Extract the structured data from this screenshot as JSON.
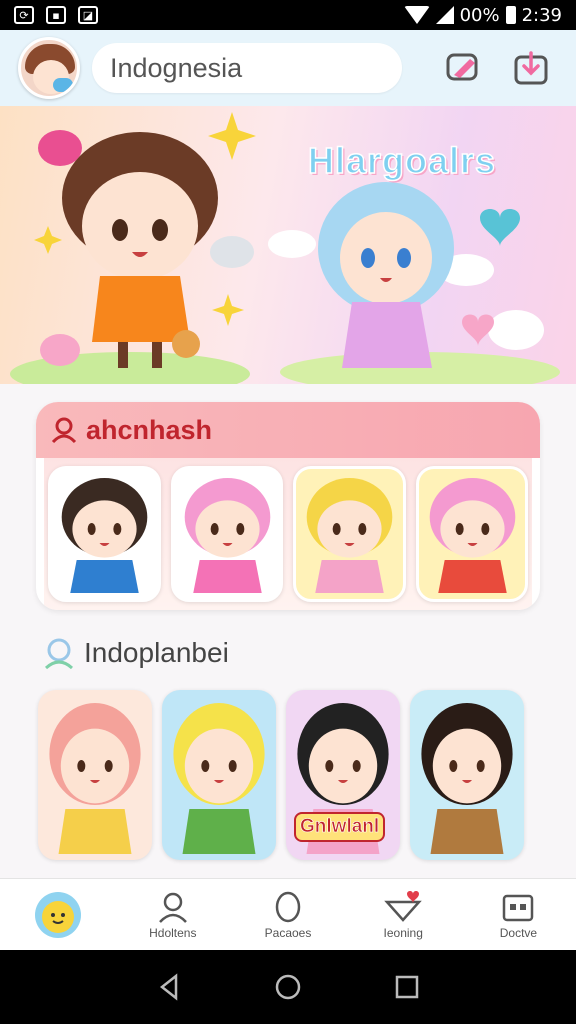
{
  "status_bar": {
    "battery_text": "00%",
    "time": "2:39",
    "left_icons": [
      "sync-icon",
      "photo-icon",
      "image-icon"
    ]
  },
  "header": {
    "search_text": "Indognesia",
    "icons": [
      "edit-bubble-icon",
      "download-icon"
    ]
  },
  "banner": {
    "title": "Hlargoalrs"
  },
  "section1": {
    "title": "ahcnhash",
    "icon": "person-icon",
    "cards": [
      {
        "hair": "#3a2a22",
        "outfit": "#2f7fd0",
        "bg": "#ffffff"
      },
      {
        "hair": "#f49ad0",
        "outfit": "#f472b6",
        "bg": "#ffffff"
      },
      {
        "hair": "#f5d547",
        "outfit": "#f4a3c8",
        "bg": "#fff2b8"
      },
      {
        "hair": "#f49ad0",
        "outfit": "#e84b3c",
        "bg": "#fff2b8"
      }
    ]
  },
  "section2": {
    "title": "Indoplanbei",
    "icon": "profile-ring-icon",
    "cards": [
      {
        "hair": "#f4a29a",
        "outfit": "#f5cf4a",
        "bg": "#fde8dc"
      },
      {
        "hair": "#f5e24a",
        "outfit": "#5fb04a",
        "bg": "#bfe6f7"
      },
      {
        "hair": "#222222",
        "outfit": "#f4a3c8",
        "bg": "#f1d7f3",
        "tag": "Gnlwlanl"
      },
      {
        "hair": "#2a1c16",
        "outfit": "#b07a3e",
        "bg": "#c9ecf7"
      }
    ]
  },
  "bottom_nav": {
    "items": [
      {
        "label": "",
        "icon": "home-mascot-icon"
      },
      {
        "label": "Hdoltens",
        "icon": "person-icon"
      },
      {
        "label": "Pacaoes",
        "icon": "face-outline-icon"
      },
      {
        "label": "Ieoning",
        "icon": "hat-heart-icon"
      },
      {
        "label": "Doctve",
        "icon": "store-icon"
      }
    ]
  },
  "colors": {
    "accent_red": "#c0252e",
    "header_bg": "#e7f4fb",
    "section_pink": "#f7a6b0"
  }
}
